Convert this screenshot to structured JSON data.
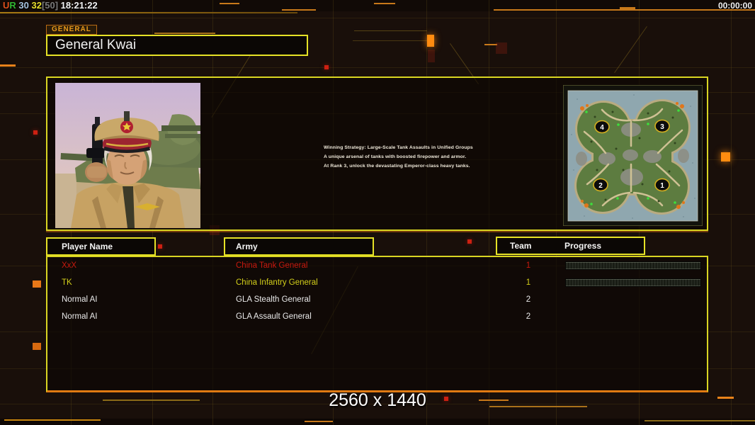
{
  "status_bar": {
    "parts": [
      {
        "text": "U",
        "color": "#e0501c"
      },
      {
        "text": "R",
        "color": "#32b632"
      },
      {
        "text": " 30",
        "color": "#a8c4e0"
      },
      {
        "text": " 32",
        "color": "#e8e02c"
      },
      {
        "text": "[50]",
        "color": "#7a7a7a"
      },
      {
        "text": " 18:21:22",
        "color": "#f2f2f2"
      }
    ],
    "timer": "00:00:00"
  },
  "header": {
    "tab_label": "GENERAL",
    "general_name": "General Kwai"
  },
  "briefing": {
    "line1": "Winning Strategy: Large-Scale Tank Assaults in Unified Groups",
    "line2": "A unique arsenal of tanks with boosted firepower and armor.",
    "line3": "At Rank 3, unlock the devastating Emperor-class heavy tanks."
  },
  "map_preview": {
    "markers": [
      {
        "label": "4"
      },
      {
        "label": "3"
      },
      {
        "label": "2"
      },
      {
        "label": "1"
      }
    ]
  },
  "players": {
    "headers": {
      "name": "Player Name",
      "army": "Army",
      "team": "Team",
      "progress": "Progress"
    },
    "rows": [
      {
        "name": "XxX",
        "army": "China Tank General",
        "team": "1",
        "color": "#c8190e",
        "has_progress": true
      },
      {
        "name": "TK",
        "army": "China Infantry General",
        "team": "1",
        "color": "#d3cf1a",
        "has_progress": true
      },
      {
        "name": "Normal AI",
        "army": "GLA Stealth General",
        "team": "2",
        "color": "#e9e9e9",
        "has_progress": false
      },
      {
        "name": "Normal AI",
        "army": "GLA Assault General",
        "team": "2",
        "color": "#e9e9e9",
        "has_progress": false
      }
    ]
  },
  "footer": {
    "resolution": "2560 x 1440"
  },
  "colors": {
    "accent_yellow": "#e6e226",
    "accent_orange": "#e87e18",
    "alert_red": "#cc2012",
    "background": "#190f0a"
  }
}
